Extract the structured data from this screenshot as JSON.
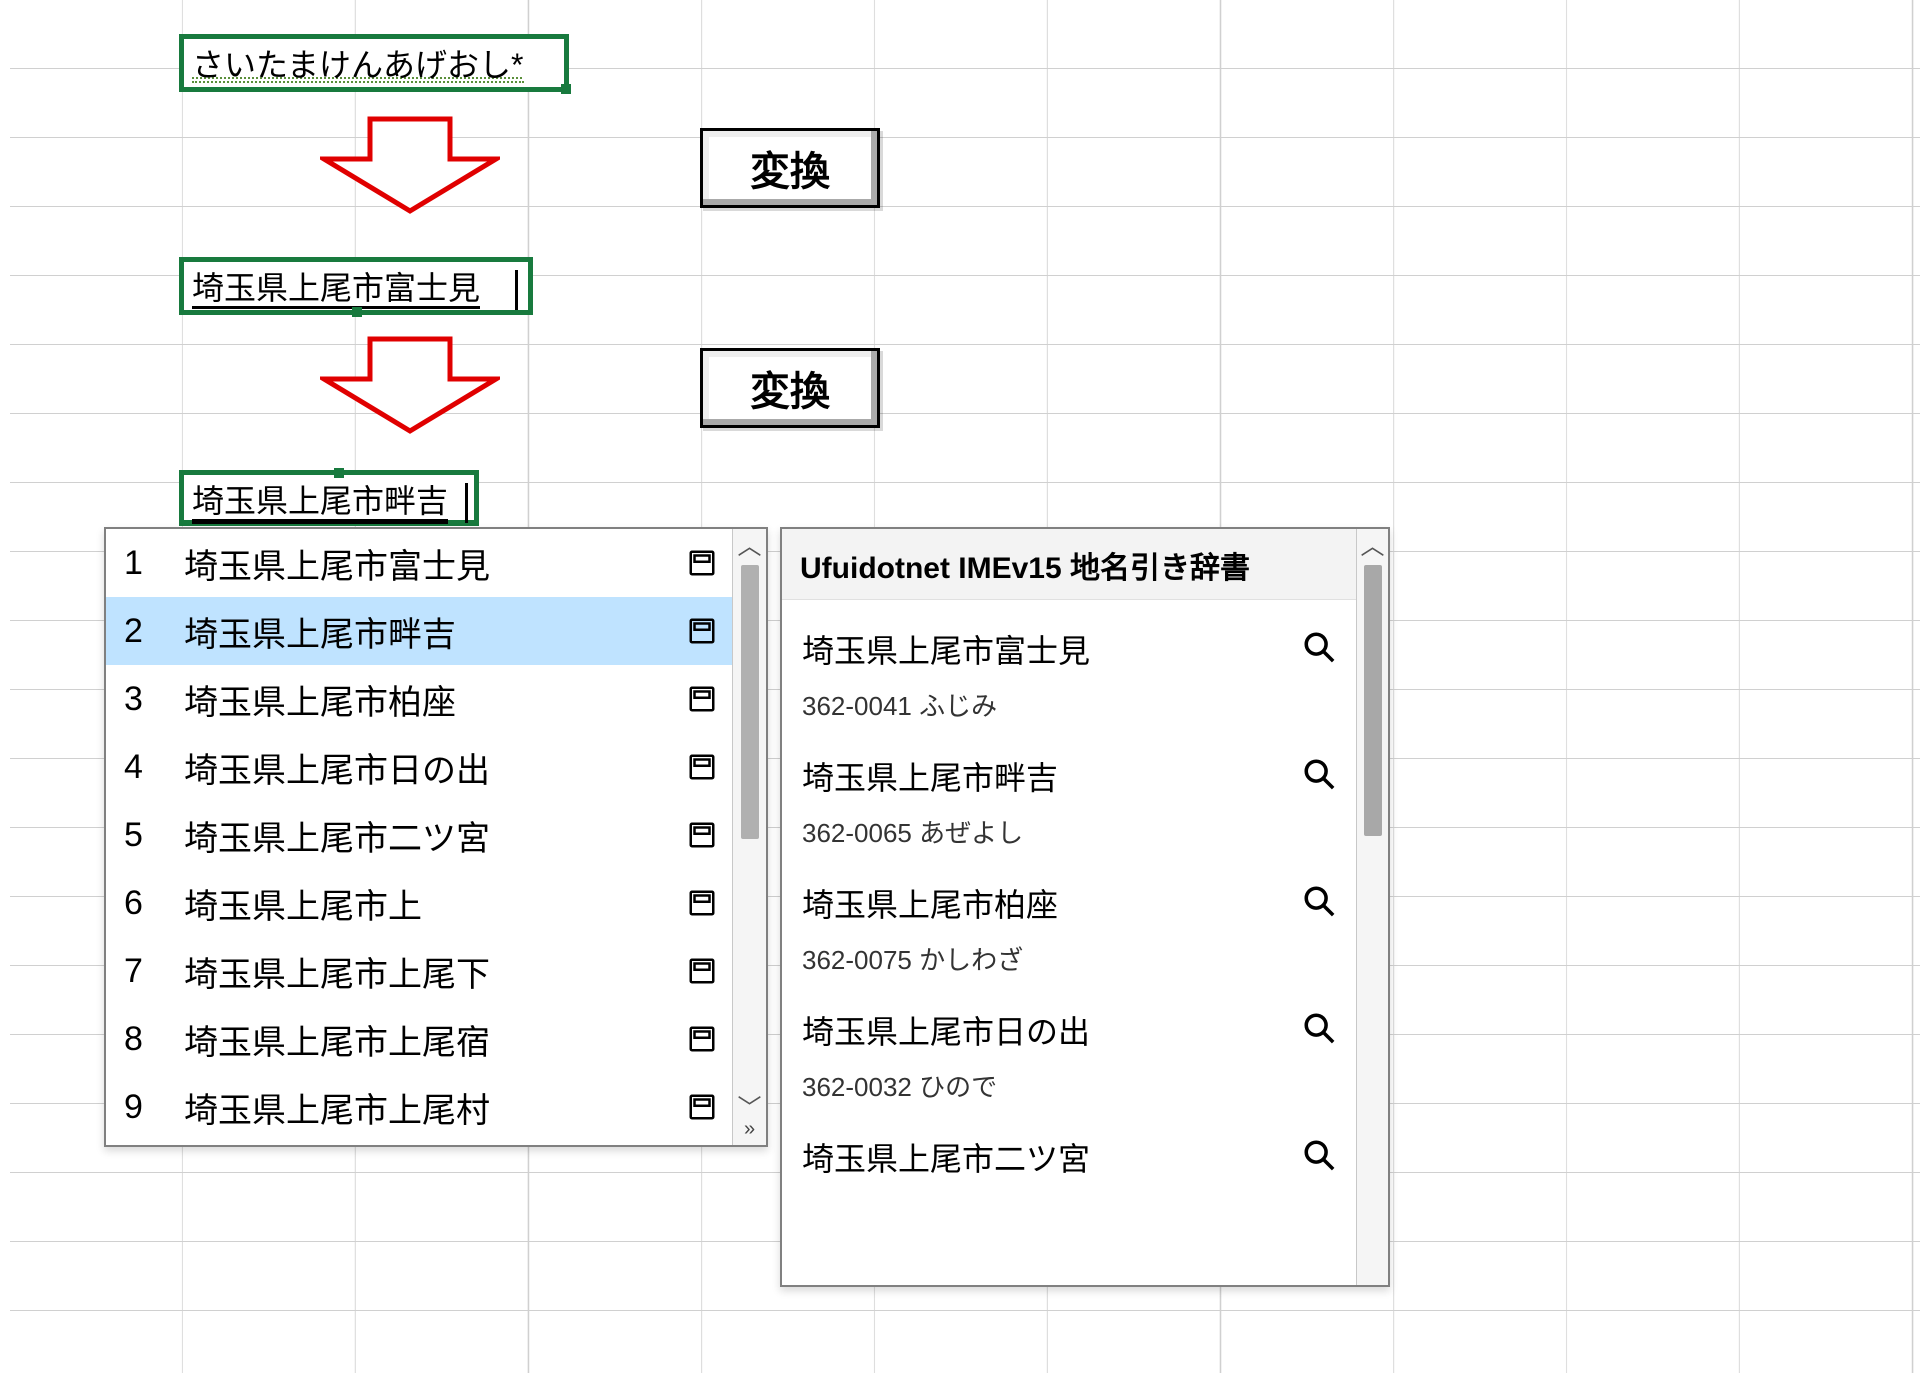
{
  "cells": {
    "input_hiragana": "さいたまけんあげおし*",
    "converted_fujimi": "埼玉県上尾市富士見",
    "converted_azeyoshi": "埼玉県上尾市畔吉"
  },
  "buttons": {
    "henkan": "変換"
  },
  "candidates": {
    "selected_index": 2,
    "items": [
      {
        "num": "1",
        "text": "埼玉県上尾市富士見"
      },
      {
        "num": "2",
        "text": "埼玉県上尾市畔吉"
      },
      {
        "num": "3",
        "text": "埼玉県上尾市柏座"
      },
      {
        "num": "4",
        "text": "埼玉県上尾市日の出"
      },
      {
        "num": "5",
        "text": "埼玉県上尾市二ツ宮"
      },
      {
        "num": "6",
        "text": "埼玉県上尾市上"
      },
      {
        "num": "7",
        "text": "埼玉県上尾市上尾下"
      },
      {
        "num": "8",
        "text": "埼玉県上尾市上尾宿"
      },
      {
        "num": "9",
        "text": "埼玉県上尾市上尾村"
      }
    ]
  },
  "dictionary": {
    "title": "Ufuidotnet IMEv15 地名引き辞書",
    "entries": [
      {
        "name": "埼玉県上尾市富士見",
        "meta": "362-0041 ふじみ"
      },
      {
        "name": "埼玉県上尾市畔吉",
        "meta": "362-0065 あぜよし"
      },
      {
        "name": "埼玉県上尾市柏座",
        "meta": "362-0075 かしわざ"
      },
      {
        "name": "埼玉県上尾市日の出",
        "meta": "362-0032 ひので"
      },
      {
        "name": "埼玉県上尾市二ツ宮",
        "meta": ""
      }
    ]
  },
  "icons": {
    "scroll_up": "︿",
    "scroll_down": "﹀",
    "expand": "»"
  }
}
